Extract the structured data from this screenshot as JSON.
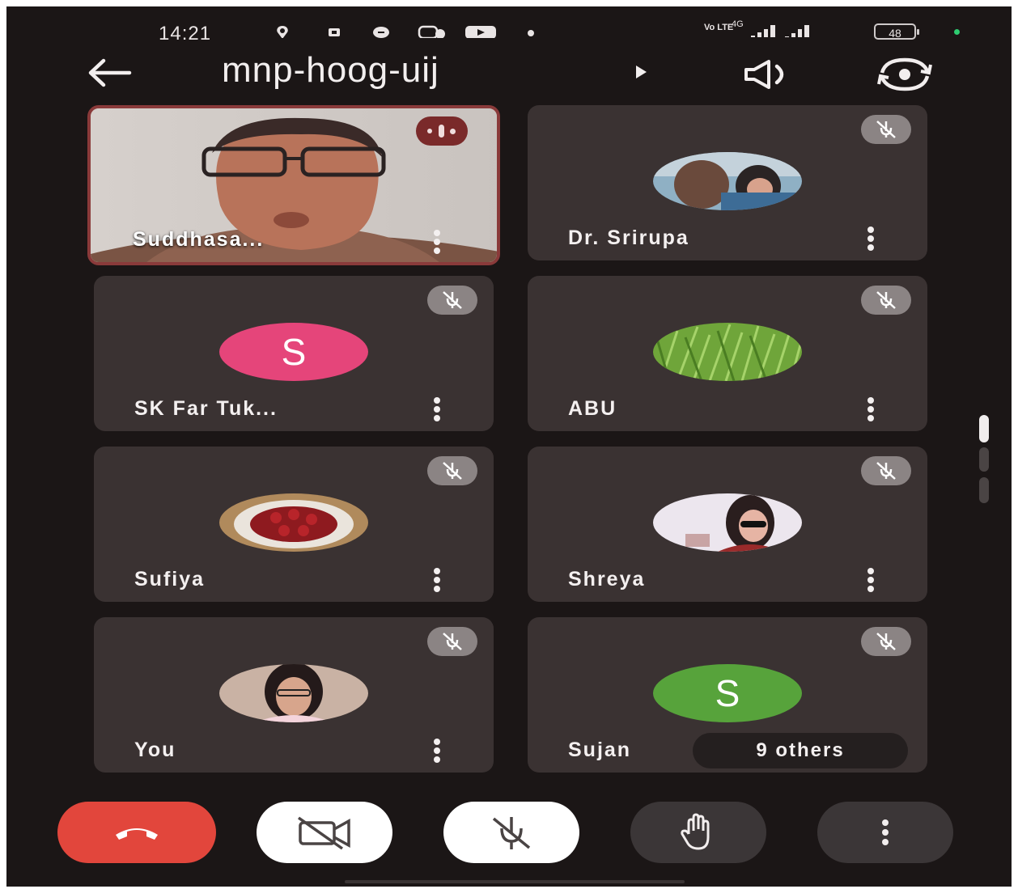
{
  "status_bar": {
    "time": "14:21",
    "network_label": "Vo LTE",
    "network_type": "4G",
    "battery": "48"
  },
  "header": {
    "meeting_code": "mnp-hoog-uij"
  },
  "participants": [
    {
      "name": "Suddhasa...",
      "type": "video",
      "speaking": true
    },
    {
      "name": "Dr. Srirupa",
      "type": "photo",
      "muted": true
    },
    {
      "name": "SK Far Tuk...",
      "type": "letter",
      "letter": "S",
      "color": "#e5457a",
      "muted": true
    },
    {
      "name": "ABU",
      "type": "photo",
      "muted": true
    },
    {
      "name": "Sufiya",
      "type": "photo",
      "muted": true
    },
    {
      "name": "Shreya",
      "type": "photo",
      "muted": true
    },
    {
      "name": "You",
      "type": "photo",
      "muted": true
    },
    {
      "name": "Sujan",
      "type": "letter",
      "letter": "S",
      "color": "#57a33b",
      "muted": true
    }
  ],
  "others_label": "9 others",
  "controls": [
    {
      "icon": "end-call-icon",
      "color": "#e2463c"
    },
    {
      "icon": "camera-off-icon",
      "color": "#ffffff"
    },
    {
      "icon": "mic-off-icon",
      "color": "#ffffff"
    },
    {
      "icon": "raise-hand-icon",
      "color": "#3b3637"
    },
    {
      "icon": "more-options-icon",
      "color": "#3b3637"
    }
  ]
}
